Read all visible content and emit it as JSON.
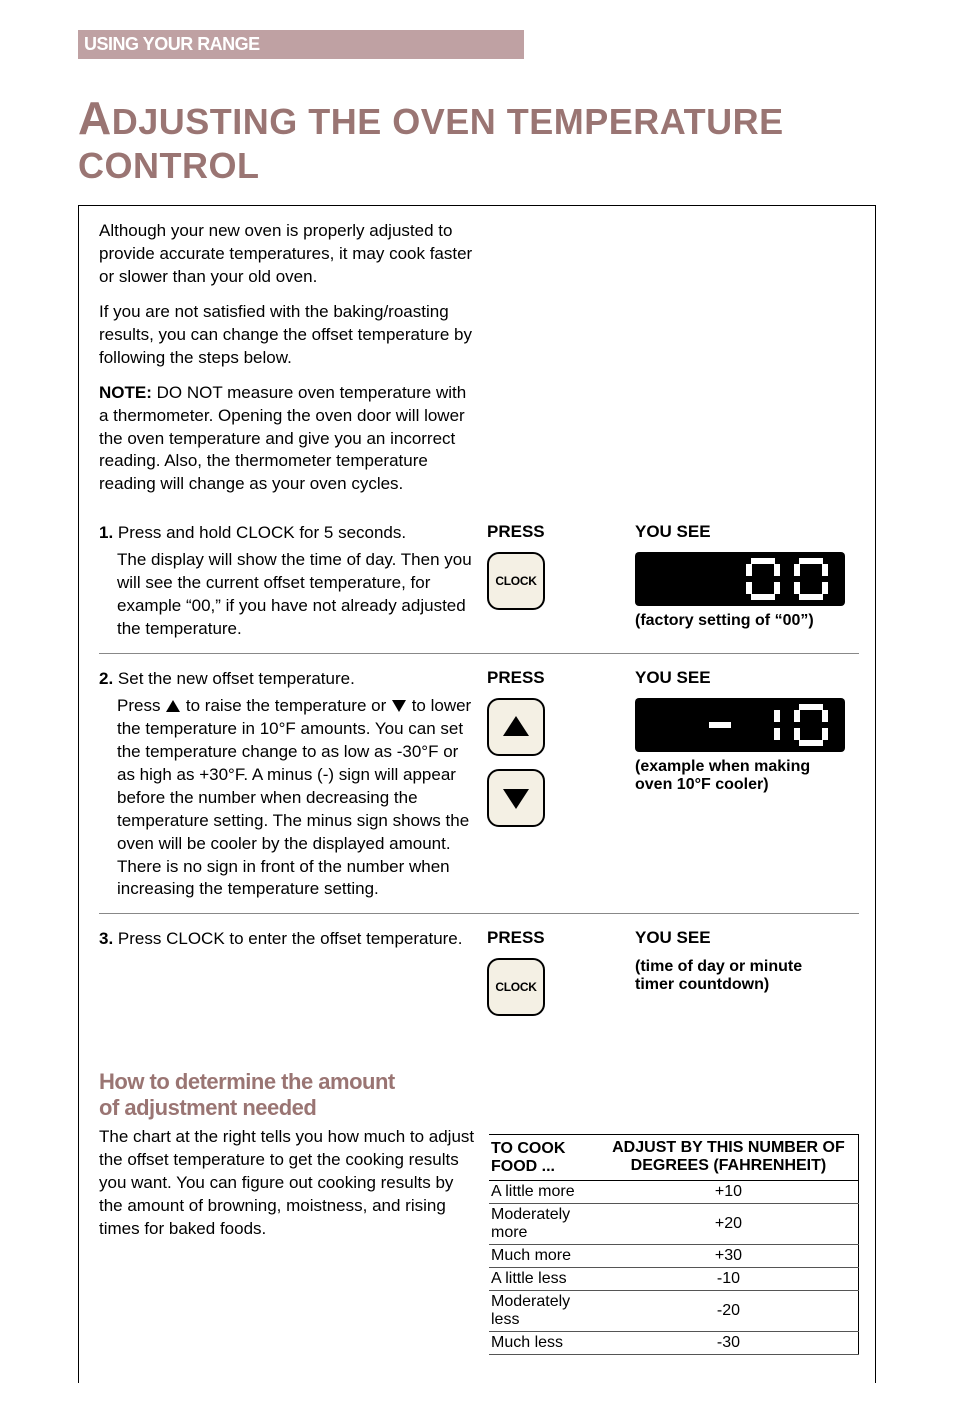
{
  "section_bar": "USING YOUR RANGE",
  "title_first": "A",
  "title_rest": "DJUSTING THE OVEN TEMPERATURE CONTROL",
  "intro": {
    "p1": "Although your new oven is properly adjusted to provide accurate temperatures, it may cook faster or slower than your old oven.",
    "p2": "If you are not satisfied with the baking/roasting results, you can change the offset temperature by following the steps below.",
    "note_label": "NOTE:",
    "note_body": " DO NOT measure oven temperature with a thermometer. Opening the oven door will lower the oven temperature and give you an incorrect reading. Also, the thermometer temperature reading will change as your oven cycles."
  },
  "col_press": "PRESS",
  "col_yousee": "YOU SEE",
  "clock_label": "CLOCK",
  "steps": {
    "s1": {
      "head": "1. Press and hold CLOCK for 5 seconds.",
      "body": "The display will show the time of day. Then you will see the current offset temperature, for example “00,” if you have not already adjusted the temperature.",
      "caption": "(factory setting of “00”)"
    },
    "s2": {
      "head": "2. Set the new offset temperature.",
      "body_a": "Press ",
      "body_b": " to raise the temperature or ",
      "body_c": " to lower the temperature in 10°F amounts. You can set the temperature change to as low as -30°F or as high as +30°F. A minus (-) sign will appear before the number when decreasing the temperature setting. The minus sign shows the oven will be cooler by the displayed amount. There is no sign in front of the number when increasing the temperature setting.",
      "caption": "(example when making oven 10°F cooler)"
    },
    "s3": {
      "head": "3. Press CLOCK to enter the offset temperature.",
      "caption": "(time of day or minute timer countdown)"
    }
  },
  "subhead": "How to determine the amount of adjustment needed",
  "adjust_para": "The chart at the right tells you how much to adjust the offset temperature to get the cooking results you want. You can figure out cooking results by the amount of browning, moistness, and rising times for baked foods.",
  "table": {
    "h1": "TO COOK FOOD ...",
    "h2": "ADJUST BY THIS NUMBER OF DEGREES (FAHRENHEIT)",
    "rows": [
      {
        "c1": "A little more",
        "c2": "+10"
      },
      {
        "c1": "Moderately more",
        "c2": "+20"
      },
      {
        "c1": "Much more",
        "c2": "+30"
      },
      {
        "c1": "A little less",
        "c2": "-10"
      },
      {
        "c1": "Moderately less",
        "c2": "-20"
      },
      {
        "c1": "Much less",
        "c2": "-30"
      }
    ]
  },
  "chart_data": {
    "type": "table",
    "title": "Oven temperature offset adjustment guide",
    "columns": [
      "TO COOK FOOD ...",
      "ADJUST BY THIS NUMBER OF DEGREES (FAHRENHEIT)"
    ],
    "rows": [
      [
        "A little more",
        10
      ],
      [
        "Moderately more",
        20
      ],
      [
        "Much more",
        30
      ],
      [
        "A little less",
        -10
      ],
      [
        "Moderately less",
        -20
      ],
      [
        "Much less",
        -30
      ]
    ]
  }
}
